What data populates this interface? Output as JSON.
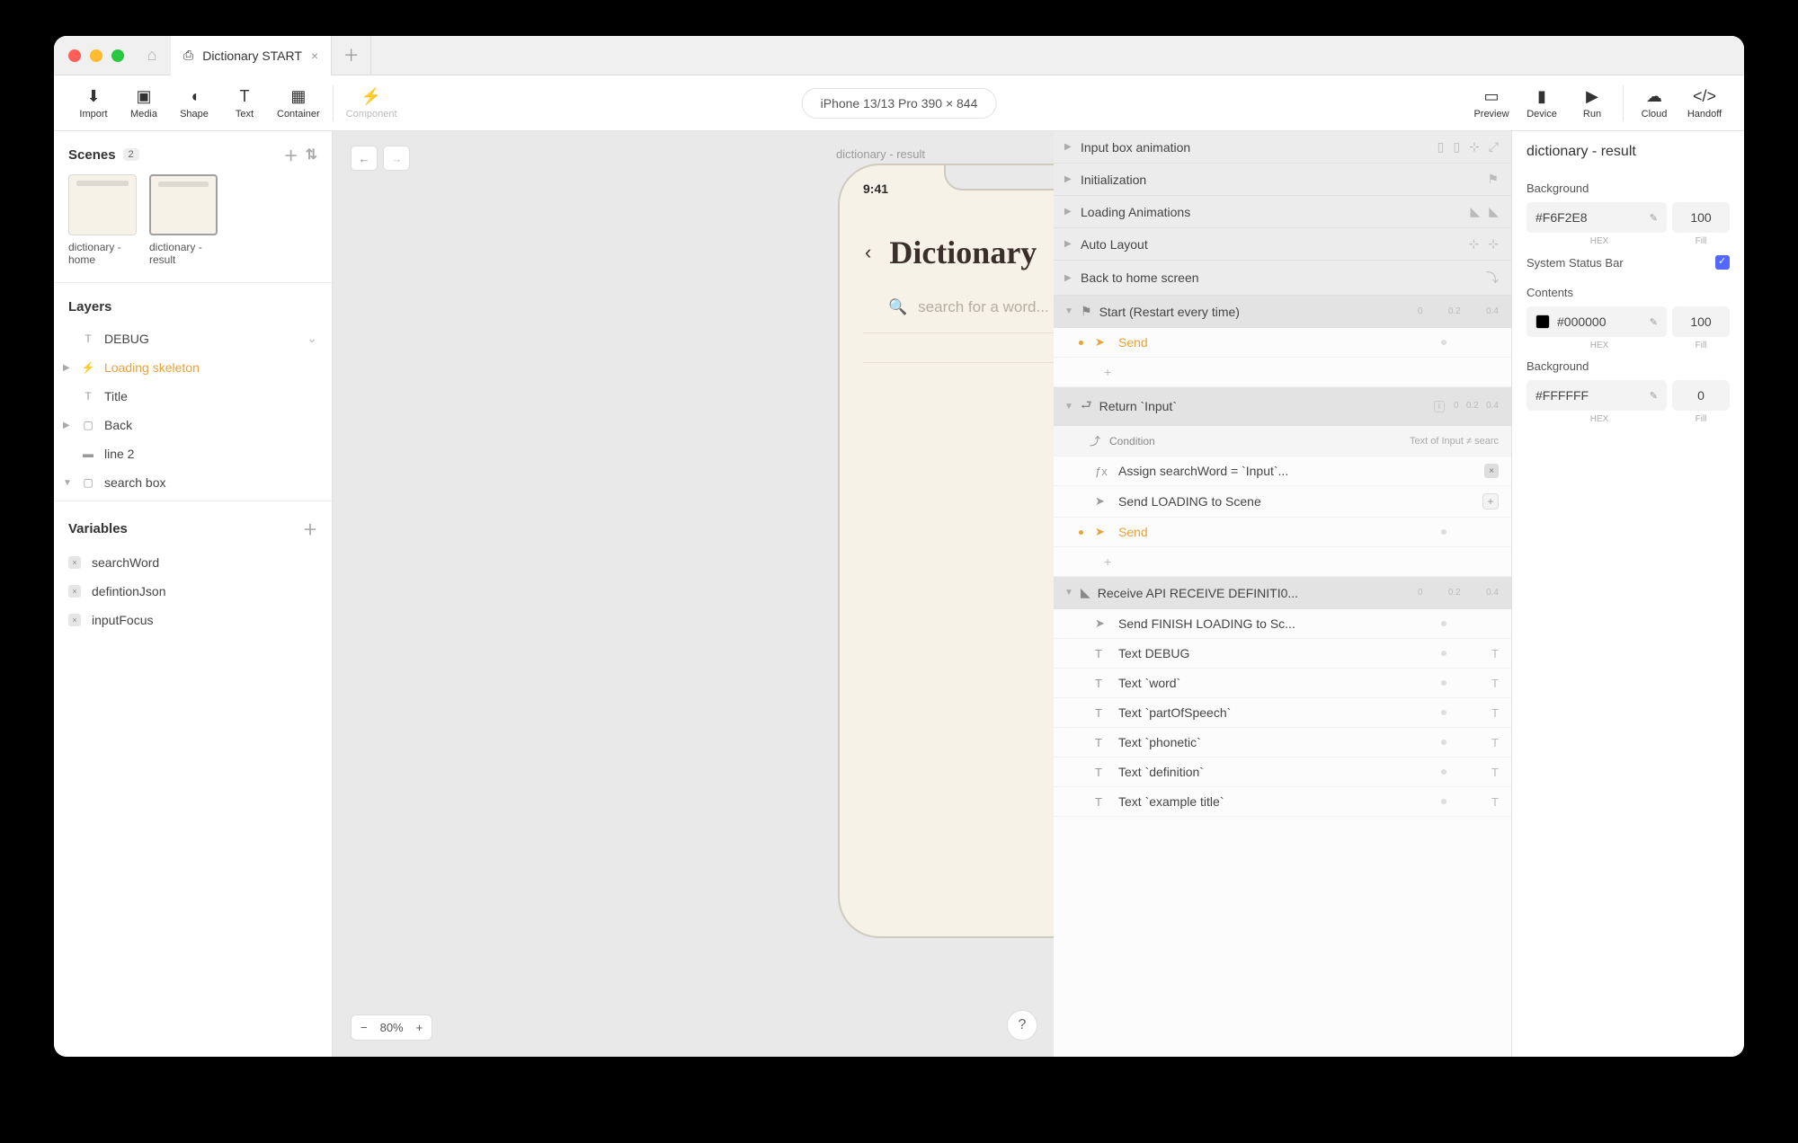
{
  "tab": {
    "title": "Dictionary START"
  },
  "toolbar": {
    "import": "Import",
    "media": "Media",
    "shape": "Shape",
    "text": "Text",
    "container": "Container",
    "component": "Component",
    "preview": "Preview",
    "device": "Device",
    "run": "Run",
    "cloud": "Cloud",
    "handoff": "Handoff"
  },
  "device": {
    "label": "iPhone 13/13 Pro  390 × 844"
  },
  "scenes": {
    "title": "Scenes",
    "count": "2",
    "items": [
      {
        "name": "dictionary - home"
      },
      {
        "name": "dictionary - result"
      }
    ]
  },
  "layers": {
    "title": "Layers",
    "items": [
      {
        "name": "DEBUG",
        "icon": "T"
      },
      {
        "name": "Loading skeleton",
        "icon": "⚡",
        "active": true,
        "disclosure": "▶"
      },
      {
        "name": "Title",
        "icon": "T"
      },
      {
        "name": "Back",
        "icon": "▢",
        "disclosure": "▶"
      },
      {
        "name": "line 2",
        "icon": "■"
      },
      {
        "name": "search box",
        "icon": "▢",
        "disclosure": "▼"
      }
    ]
  },
  "variables": {
    "title": "Variables",
    "items": [
      "searchWord",
      "defintionJson",
      "inputFocus"
    ]
  },
  "canvas": {
    "sceneLabel": "dictionary - result",
    "time": "9:41",
    "heading": "Dictionary",
    "placeholder": "search for a word...",
    "zoom": "80%"
  },
  "timeline": {
    "groups": [
      {
        "label": "Input box animation"
      },
      {
        "label": "Initialization",
        "ricon": "⚑"
      },
      {
        "label": "Loading Animations",
        "ricon": "◣◣"
      },
      {
        "label": "Auto Layout",
        "ricon": "⊹ ⊹"
      },
      {
        "label": "Back to home screen",
        "ricon": "⤵"
      }
    ],
    "start": {
      "label": "Start (Restart every time)",
      "send": "Send",
      "scale": [
        "0",
        "0.2",
        "0.4"
      ]
    },
    "return": {
      "label": "Return `Input`",
      "condition": "Condition",
      "condNote": "Text of Input ≠ searc",
      "assign": "Assign searchWord = `Input`...",
      "sendLoading": "Send LOADING to Scene",
      "send": "Send",
      "scale": [
        "0",
        "0.2",
        "0.4"
      ]
    },
    "receive": {
      "label": "Receive API RECEIVE DEFINITI0...",
      "scale": [
        "0",
        "0.2",
        "0.4"
      ],
      "finish": "Send FINISH LOADING to Sc...",
      "rows": [
        "Text DEBUG",
        "Text `word`",
        "Text `partOfSpeech`",
        "Text `phonetic`",
        "Text `definition`",
        "Text `example title`"
      ]
    }
  },
  "inspector": {
    "title": "dictionary - result",
    "background": "Background",
    "bgHex": "#F6F2E8",
    "bgFill": "100",
    "hexLabel": "HEX",
    "fillLabel": "Fill",
    "statusBar": "System Status Bar",
    "contents": "Contents",
    "contentHex": "#000000",
    "contentFill": "100",
    "background2": "Background",
    "bg2Hex": "#FFFFFF",
    "bg2Fill": "0"
  }
}
